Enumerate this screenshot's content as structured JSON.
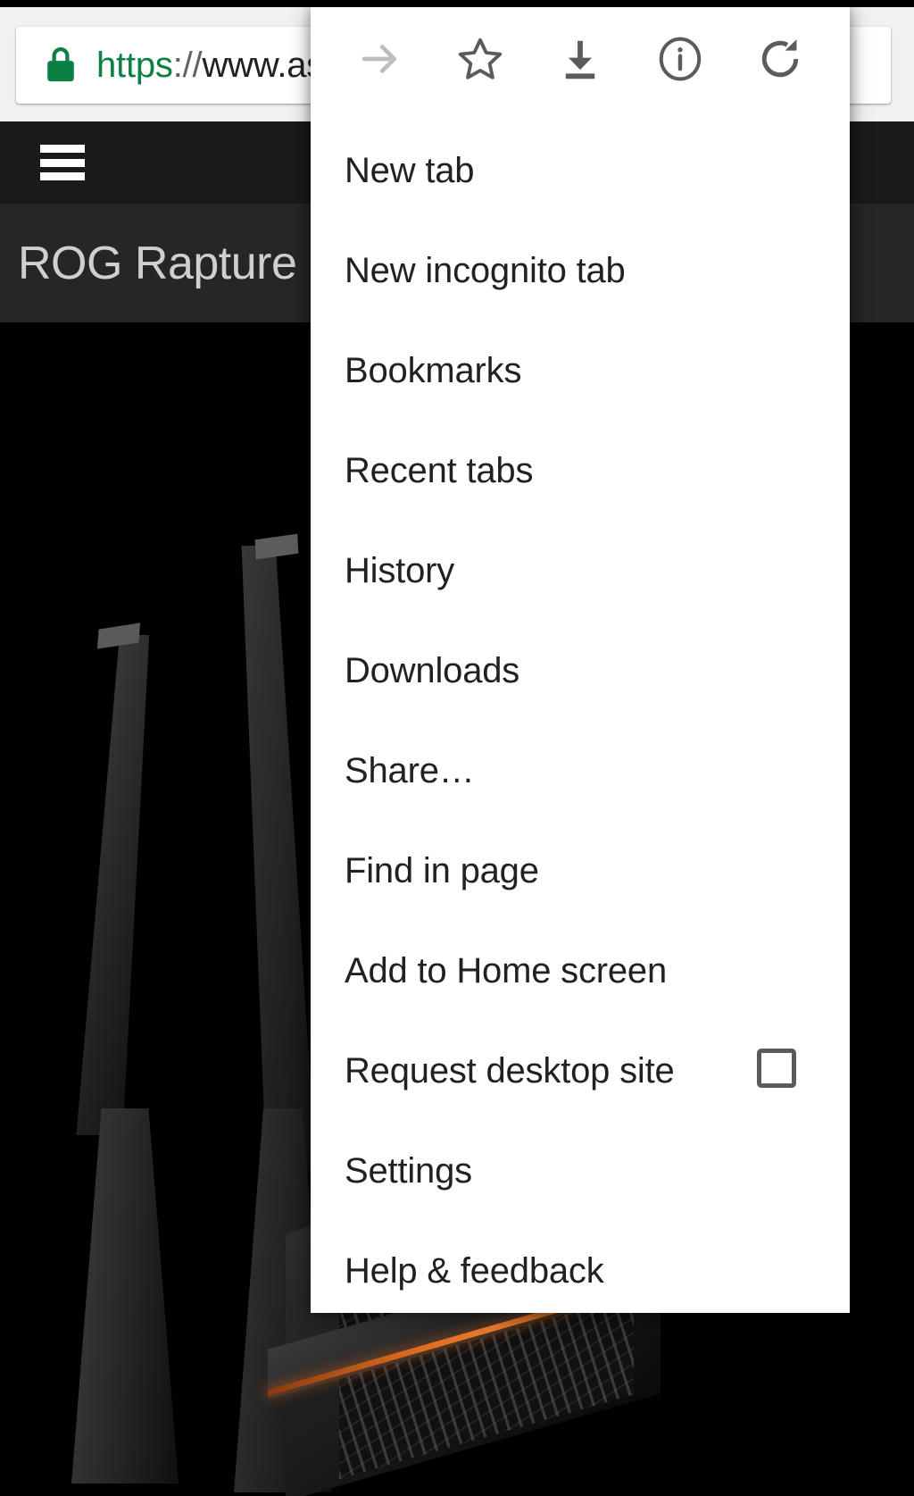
{
  "browser": {
    "omnibox": {
      "secure_icon": "lock-icon",
      "url_scheme": "https",
      "url_separator": "://",
      "url_host_visible": "www.as",
      "full_visible_text": "https://www.as"
    }
  },
  "site": {
    "nav_icon": "hamburger-menu-icon",
    "page_title_visible": "ROG Rapture GT",
    "hero_alt": "ROG Rapture gaming router product photo"
  },
  "app_menu": {
    "icon_row": [
      {
        "name": "forward-arrow-icon",
        "label": "Forward",
        "enabled": false
      },
      {
        "name": "star-icon",
        "label": "Bookmark",
        "enabled": true
      },
      {
        "name": "download-icon",
        "label": "Download page",
        "enabled": true
      },
      {
        "name": "info-icon",
        "label": "Page info",
        "enabled": true
      },
      {
        "name": "reload-icon",
        "label": "Reload",
        "enabled": true
      }
    ],
    "items": [
      {
        "label": "New tab",
        "type": "item"
      },
      {
        "label": "New incognito tab",
        "type": "item"
      },
      {
        "label": "Bookmarks",
        "type": "item"
      },
      {
        "label": "Recent tabs",
        "type": "item"
      },
      {
        "label": "History",
        "type": "item"
      },
      {
        "label": "Downloads",
        "type": "item"
      },
      {
        "label": "Share…",
        "type": "item"
      },
      {
        "label": "Find in page",
        "type": "item"
      },
      {
        "label": "Add to Home screen",
        "type": "item"
      },
      {
        "label": "Request desktop site",
        "type": "checkbox",
        "checked": false
      },
      {
        "label": "Settings",
        "type": "item"
      },
      {
        "label": "Help & feedback",
        "type": "item"
      }
    ]
  },
  "colors": {
    "menu_background": "#ffffff",
    "menu_text": "#212121",
    "toolbar_background": "#f1f1f1",
    "omnibox_background": "#ffffff",
    "secure_green": "#0b8043",
    "site_navbar": "#1a1a1a",
    "site_titlebar": "#262626",
    "site_title_text": "#cfcfcf",
    "hero_background": "#000000",
    "router_accent": "#d4661f",
    "icon_enabled": "#5b5b5b",
    "icon_disabled": "#bdbdbd"
  }
}
